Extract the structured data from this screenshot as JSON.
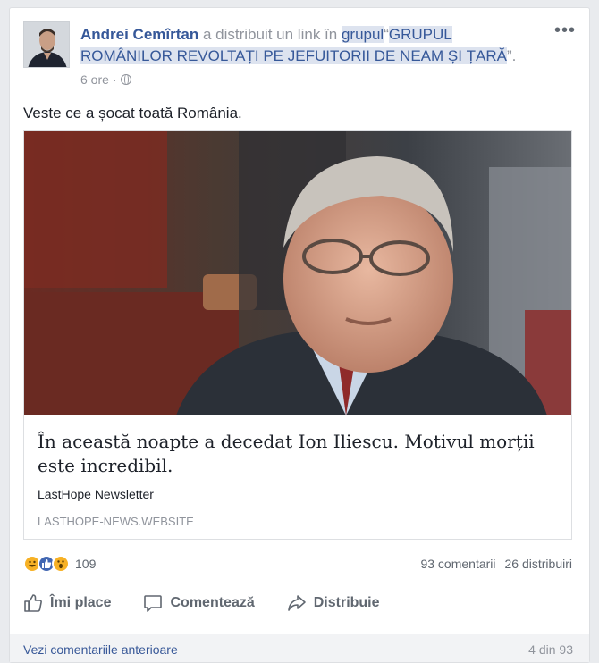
{
  "post": {
    "author": "Andrei Cemîrtan",
    "action_text": " a distribuit un link în ",
    "group_word": "grupul",
    "quote_open": "“",
    "group_name": "GRUPUL ROMÂNILOR REVOLTAȚI PE JEFUITORII DE NEAM ȘI ȚARĂ",
    "quote_close": "”.",
    "time": "6 ore",
    "separator": "·",
    "more_icon": "ellipsis-icon",
    "text": "Veste ce a șocat toată România."
  },
  "link": {
    "title": "În această noapte a decedat Ion Iliescu. Motivul morții este incredibil.",
    "description": "LastHope Newsletter",
    "domain": "LASTHOPE-NEWS.WEBSITE"
  },
  "reactions": {
    "icons": [
      "haha-icon",
      "like-icon",
      "wow-icon"
    ],
    "count": "109"
  },
  "stats": {
    "comments": "93 comentarii",
    "shares": "26 distribuiri"
  },
  "actions": {
    "like": "Îmi place",
    "comment": "Comentează",
    "share": "Distribuie"
  },
  "footer": {
    "previous_comments": "Vezi comentariile anterioare",
    "pager": "4 din 93"
  },
  "colors": {
    "link_blue": "#365899",
    "muted": "#90949c",
    "like_blue": "#4267b2",
    "reaction_yellow": "#f7b125"
  }
}
